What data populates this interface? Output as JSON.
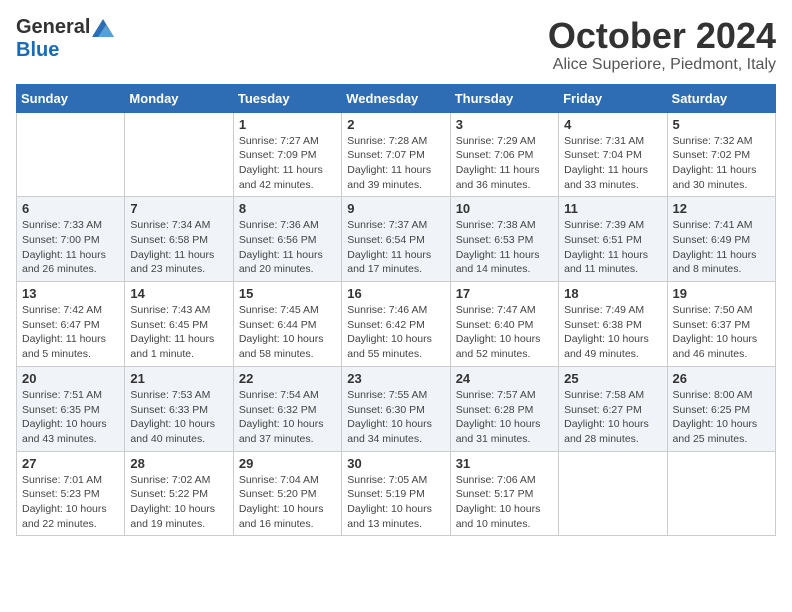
{
  "logo": {
    "general": "General",
    "blue": "Blue"
  },
  "title": "October 2024",
  "location": "Alice Superiore, Piedmont, Italy",
  "weekdays": [
    "Sunday",
    "Monday",
    "Tuesday",
    "Wednesday",
    "Thursday",
    "Friday",
    "Saturday"
  ],
  "weeks": [
    [
      null,
      null,
      {
        "day": 1,
        "sunrise": "7:27 AM",
        "sunset": "7:09 PM",
        "daylight": "11 hours and 42 minutes."
      },
      {
        "day": 2,
        "sunrise": "7:28 AM",
        "sunset": "7:07 PM",
        "daylight": "11 hours and 39 minutes."
      },
      {
        "day": 3,
        "sunrise": "7:29 AM",
        "sunset": "7:06 PM",
        "daylight": "11 hours and 36 minutes."
      },
      {
        "day": 4,
        "sunrise": "7:31 AM",
        "sunset": "7:04 PM",
        "daylight": "11 hours and 33 minutes."
      },
      {
        "day": 5,
        "sunrise": "7:32 AM",
        "sunset": "7:02 PM",
        "daylight": "11 hours and 30 minutes."
      }
    ],
    [
      {
        "day": 6,
        "sunrise": "7:33 AM",
        "sunset": "7:00 PM",
        "daylight": "11 hours and 26 minutes."
      },
      {
        "day": 7,
        "sunrise": "7:34 AM",
        "sunset": "6:58 PM",
        "daylight": "11 hours and 23 minutes."
      },
      {
        "day": 8,
        "sunrise": "7:36 AM",
        "sunset": "6:56 PM",
        "daylight": "11 hours and 20 minutes."
      },
      {
        "day": 9,
        "sunrise": "7:37 AM",
        "sunset": "6:54 PM",
        "daylight": "11 hours and 17 minutes."
      },
      {
        "day": 10,
        "sunrise": "7:38 AM",
        "sunset": "6:53 PM",
        "daylight": "11 hours and 14 minutes."
      },
      {
        "day": 11,
        "sunrise": "7:39 AM",
        "sunset": "6:51 PM",
        "daylight": "11 hours and 11 minutes."
      },
      {
        "day": 12,
        "sunrise": "7:41 AM",
        "sunset": "6:49 PM",
        "daylight": "11 hours and 8 minutes."
      }
    ],
    [
      {
        "day": 13,
        "sunrise": "7:42 AM",
        "sunset": "6:47 PM",
        "daylight": "11 hours and 5 minutes."
      },
      {
        "day": 14,
        "sunrise": "7:43 AM",
        "sunset": "6:45 PM",
        "daylight": "11 hours and 1 minute."
      },
      {
        "day": 15,
        "sunrise": "7:45 AM",
        "sunset": "6:44 PM",
        "daylight": "10 hours and 58 minutes."
      },
      {
        "day": 16,
        "sunrise": "7:46 AM",
        "sunset": "6:42 PM",
        "daylight": "10 hours and 55 minutes."
      },
      {
        "day": 17,
        "sunrise": "7:47 AM",
        "sunset": "6:40 PM",
        "daylight": "10 hours and 52 minutes."
      },
      {
        "day": 18,
        "sunrise": "7:49 AM",
        "sunset": "6:38 PM",
        "daylight": "10 hours and 49 minutes."
      },
      {
        "day": 19,
        "sunrise": "7:50 AM",
        "sunset": "6:37 PM",
        "daylight": "10 hours and 46 minutes."
      }
    ],
    [
      {
        "day": 20,
        "sunrise": "7:51 AM",
        "sunset": "6:35 PM",
        "daylight": "10 hours and 43 minutes."
      },
      {
        "day": 21,
        "sunrise": "7:53 AM",
        "sunset": "6:33 PM",
        "daylight": "10 hours and 40 minutes."
      },
      {
        "day": 22,
        "sunrise": "7:54 AM",
        "sunset": "6:32 PM",
        "daylight": "10 hours and 37 minutes."
      },
      {
        "day": 23,
        "sunrise": "7:55 AM",
        "sunset": "6:30 PM",
        "daylight": "10 hours and 34 minutes."
      },
      {
        "day": 24,
        "sunrise": "7:57 AM",
        "sunset": "6:28 PM",
        "daylight": "10 hours and 31 minutes."
      },
      {
        "day": 25,
        "sunrise": "7:58 AM",
        "sunset": "6:27 PM",
        "daylight": "10 hours and 28 minutes."
      },
      {
        "day": 26,
        "sunrise": "8:00 AM",
        "sunset": "6:25 PM",
        "daylight": "10 hours and 25 minutes."
      }
    ],
    [
      {
        "day": 27,
        "sunrise": "7:01 AM",
        "sunset": "5:23 PM",
        "daylight": "10 hours and 22 minutes."
      },
      {
        "day": 28,
        "sunrise": "7:02 AM",
        "sunset": "5:22 PM",
        "daylight": "10 hours and 19 minutes."
      },
      {
        "day": 29,
        "sunrise": "7:04 AM",
        "sunset": "5:20 PM",
        "daylight": "10 hours and 16 minutes."
      },
      {
        "day": 30,
        "sunrise": "7:05 AM",
        "sunset": "5:19 PM",
        "daylight": "10 hours and 13 minutes."
      },
      {
        "day": 31,
        "sunrise": "7:06 AM",
        "sunset": "5:17 PM",
        "daylight": "10 hours and 10 minutes."
      },
      null,
      null
    ]
  ]
}
